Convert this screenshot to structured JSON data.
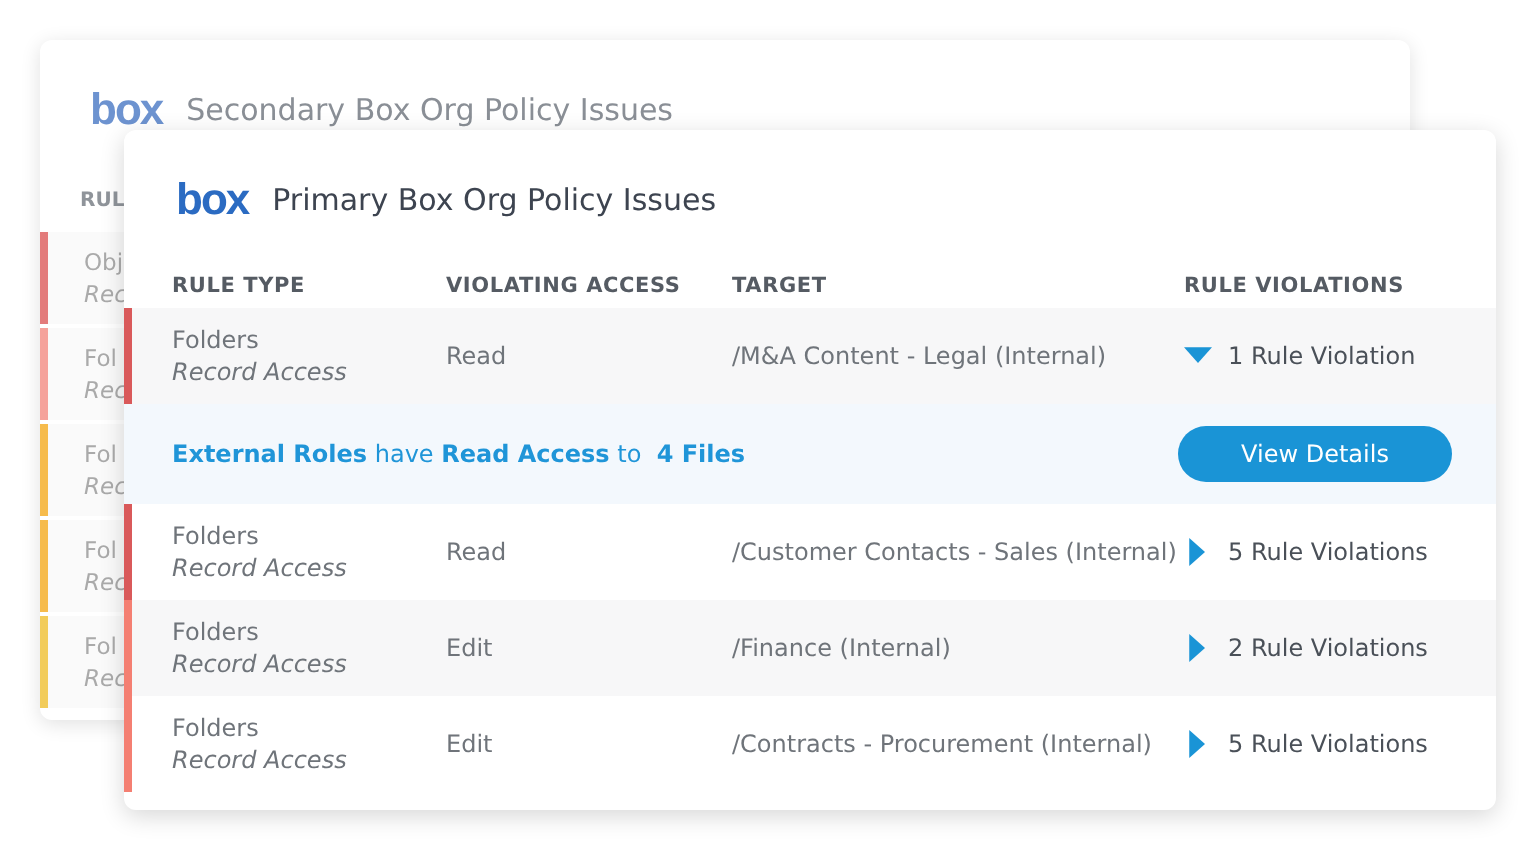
{
  "secondary_panel": {
    "logo": "box",
    "title": "Secondary Box Org Policy Issues",
    "columns": [
      "RUL"
    ],
    "rows": [
      {
        "rule_type": "Obj",
        "subtitle": "Rec",
        "color": "#e37b7b"
      },
      {
        "rule_type": "Fol",
        "subtitle": "Rec",
        "color": "#f5a29b"
      },
      {
        "rule_type": "Fol",
        "subtitle": "Rec",
        "color": "#f6bb4c"
      },
      {
        "rule_type": "Fol",
        "subtitle": "Rec",
        "color": "#f6bb4c"
      },
      {
        "rule_type": "Fol",
        "subtitle": "Rec",
        "color": "#f2cc5a"
      }
    ]
  },
  "primary_panel": {
    "logo": "box",
    "title": "Primary Box Org Policy Issues",
    "columns": [
      "RULE TYPE",
      "VIOLATING ACCESS",
      "TARGET",
      "RULE VIOLATIONS"
    ],
    "rows": [
      {
        "rule_type": "Folders",
        "subtitle": "Record Access",
        "access": "Read",
        "target": "/M&A Content - Legal (Internal)",
        "violations": "1 Rule Violation",
        "expanded": true,
        "color": "#d9595a",
        "detail": {
          "text": "**External Roles** have **Read Access** to  **4 Files**",
          "button": "View Details"
        }
      },
      {
        "rule_type": "Folders",
        "subtitle": "Record Access",
        "access": "Read",
        "target": "/Customer Contacts - Sales (Internal)",
        "violations": "5 Rule Violations",
        "expanded": false,
        "color": "#d9595a"
      },
      {
        "rule_type": "Folders",
        "subtitle": "Record Access",
        "access": "Edit",
        "target": "/Finance (Internal)",
        "violations": "2 Rule Violations",
        "expanded": false,
        "color": "#f47f72"
      },
      {
        "rule_type": "Folders",
        "subtitle": "Record Access",
        "access": "Edit",
        "target": "/Contracts - Procurement (Internal)",
        "violations": "5 Rule Violations",
        "expanded": false,
        "color": "#f47f72"
      }
    ]
  }
}
